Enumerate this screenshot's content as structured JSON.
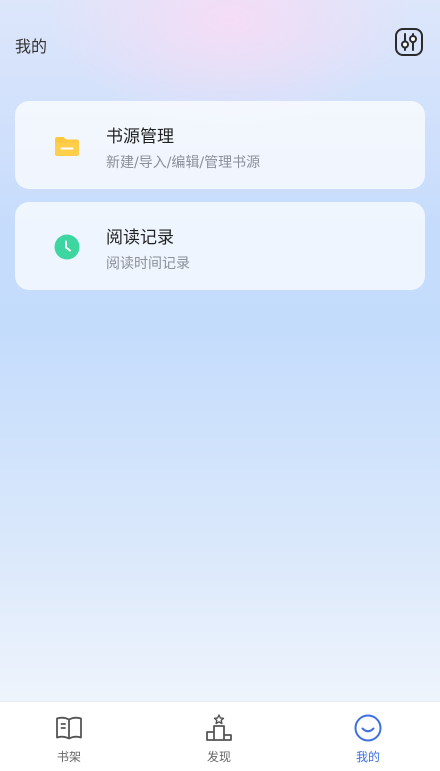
{
  "header": {
    "title": "我的",
    "settings_icon": "sliders-settings-icon"
  },
  "menu": [
    {
      "title": "书源管理",
      "subtitle": "新建/导入/编辑/管理书源",
      "icon": "folder-icon",
      "icon_color": "#FFC83D"
    },
    {
      "title": "阅读记录",
      "subtitle": "阅读时间记录",
      "icon": "clock-icon",
      "icon_color": "#3DD6A0"
    }
  ],
  "tabbar": {
    "active_color": "#3D6FE0",
    "tabs": [
      {
        "label": "书架",
        "icon": "book-icon",
        "active": false
      },
      {
        "label": "发现",
        "icon": "podium-icon",
        "active": false
      },
      {
        "label": "我的",
        "icon": "smile-icon",
        "active": true
      }
    ]
  }
}
